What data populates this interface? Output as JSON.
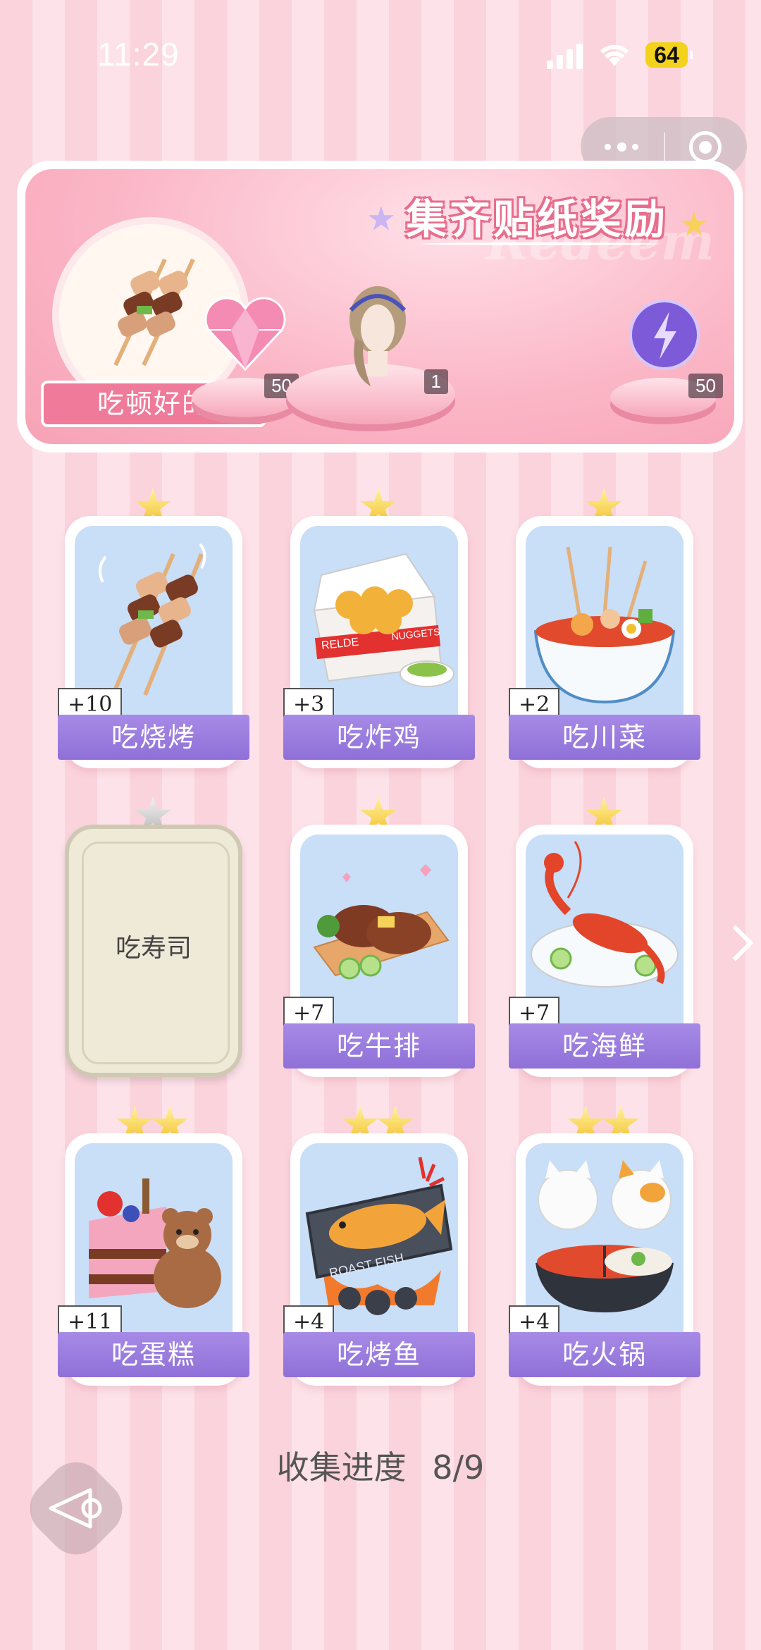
{
  "status_bar": {
    "time": "11:29",
    "battery": "64"
  },
  "banner": {
    "title": "集齐贴纸奖励",
    "watermark": "Redeem",
    "theme_label": "吃顿好的",
    "rewards": [
      {
        "icon": "heart-gem-icon",
        "count": "50"
      },
      {
        "icon": "hair-accessory-icon",
        "count": "1"
      },
      {
        "icon": "energy-orb-icon",
        "count": "50"
      }
    ]
  },
  "cards": [
    {
      "label": "吃烧烤",
      "count": "+10",
      "stars": 1,
      "icon": "skewers-icon",
      "collected": true
    },
    {
      "label": "吃炸鸡",
      "count": "+3",
      "stars": 1,
      "icon": "nuggets-icon",
      "collected": true
    },
    {
      "label": "吃川菜",
      "count": "+2",
      "stars": 1,
      "icon": "spicy-bowl-icon",
      "collected": true
    },
    {
      "label": "吃寿司",
      "count": "",
      "stars": 1,
      "icon": "sushi-icon",
      "collected": false
    },
    {
      "label": "吃牛排",
      "count": "+7",
      "stars": 1,
      "icon": "steak-icon",
      "collected": true
    },
    {
      "label": "吃海鲜",
      "count": "+7",
      "stars": 1,
      "icon": "lobster-icon",
      "collected": true
    },
    {
      "label": "吃蛋糕",
      "count": "+11",
      "stars": 2,
      "icon": "cake-icon",
      "collected": true
    },
    {
      "label": "吃烤鱼",
      "count": "+4",
      "stars": 2,
      "icon": "roast-fish-icon",
      "collected": true
    },
    {
      "label": "吃火锅",
      "count": "+4",
      "stars": 2,
      "icon": "hotpot-icon",
      "collected": true
    }
  ],
  "card_art_text": {
    "nuggets_box": "NUGGETS",
    "nuggets_bag": "RELDE",
    "roast_fish": "ROAST FISH"
  },
  "progress": {
    "label": "收集进度",
    "value": "8/9"
  },
  "colors": {
    "accent_purple": "#9a7ce0",
    "banner_pink": "#f7a2b6",
    "star_gold": "#f3c02c"
  }
}
